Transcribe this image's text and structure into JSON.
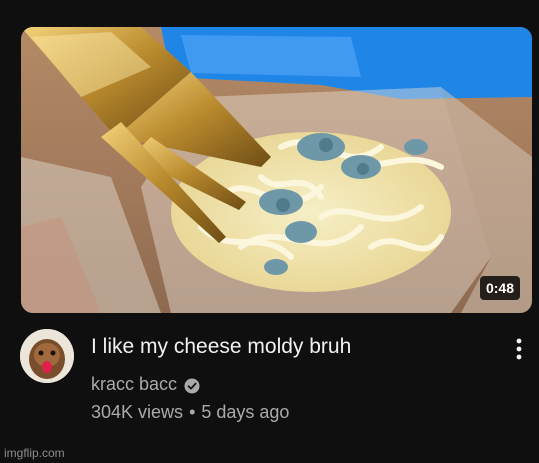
{
  "video": {
    "duration": "0:48",
    "title": "I like my cheese moldy bruh"
  },
  "channel": {
    "name": "kracc bacc",
    "verified_icon": "verified-check-icon"
  },
  "stats": {
    "views": "304K views",
    "separator": "•",
    "age": "5 days ago"
  },
  "menu": {
    "icon": "more-vertical-icon"
  },
  "watermark": "imgflip.com",
  "colors": {
    "background": "#0f0f0f",
    "title": "#f1f1f1",
    "secondary_text": "#aaaaaa",
    "duration_badge": "#000000"
  }
}
